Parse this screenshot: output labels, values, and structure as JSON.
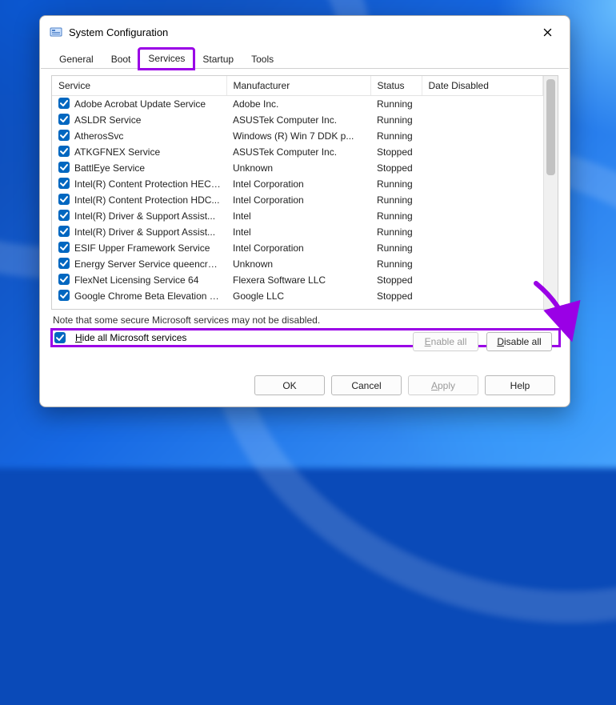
{
  "window": {
    "title": "System Configuration"
  },
  "tabs": {
    "general": "General",
    "boot": "Boot",
    "services": "Services",
    "startup": "Startup",
    "tools": "Tools",
    "active": "services",
    "highlighted": "services"
  },
  "columns": {
    "service": "Service",
    "manufacturer": "Manufacturer",
    "status": "Status",
    "date_disabled": "Date Disabled"
  },
  "services": [
    {
      "checked": true,
      "name": "Adobe Acrobat Update Service",
      "manufacturer": "Adobe Inc.",
      "status": "Running"
    },
    {
      "checked": true,
      "name": "ASLDR Service",
      "manufacturer": "ASUSTek Computer Inc.",
      "status": "Running"
    },
    {
      "checked": true,
      "name": "AtherosSvc",
      "manufacturer": "Windows (R) Win 7 DDK p...",
      "status": "Running"
    },
    {
      "checked": true,
      "name": "ATKGFNEX Service",
      "manufacturer": "ASUSTek Computer Inc.",
      "status": "Stopped"
    },
    {
      "checked": true,
      "name": "BattlEye Service",
      "manufacturer": "Unknown",
      "status": "Stopped"
    },
    {
      "checked": true,
      "name": "Intel(R) Content Protection HECI...",
      "manufacturer": "Intel Corporation",
      "status": "Running"
    },
    {
      "checked": true,
      "name": "Intel(R) Content Protection HDC...",
      "manufacturer": "Intel Corporation",
      "status": "Running"
    },
    {
      "checked": true,
      "name": "Intel(R) Driver & Support Assist...",
      "manufacturer": "Intel",
      "status": "Running"
    },
    {
      "checked": true,
      "name": "Intel(R) Driver & Support Assist...",
      "manufacturer": "Intel",
      "status": "Running"
    },
    {
      "checked": true,
      "name": "ESIF Upper Framework Service",
      "manufacturer": "Intel Corporation",
      "status": "Running"
    },
    {
      "checked": true,
      "name": "Energy Server Service queencreek",
      "manufacturer": "Unknown",
      "status": "Running"
    },
    {
      "checked": true,
      "name": "FlexNet Licensing Service 64",
      "manufacturer": "Flexera Software LLC",
      "status": "Stopped"
    },
    {
      "checked": true,
      "name": "Google Chrome Beta Elevation S...",
      "manufacturer": "Google LLC",
      "status": "Stopped"
    }
  ],
  "note": "Note that some secure Microsoft services may not be disabled.",
  "buttons": {
    "enable_all": "Enable all",
    "disable_all": "Disable all",
    "ok": "OK",
    "cancel": "Cancel",
    "apply": "Apply",
    "help": "Help"
  },
  "hide_ms": {
    "checked": true,
    "label": "Hide all Microsoft services"
  },
  "colors": {
    "highlight": "#9a00e6",
    "checkbox_blue": "#0067c0"
  }
}
